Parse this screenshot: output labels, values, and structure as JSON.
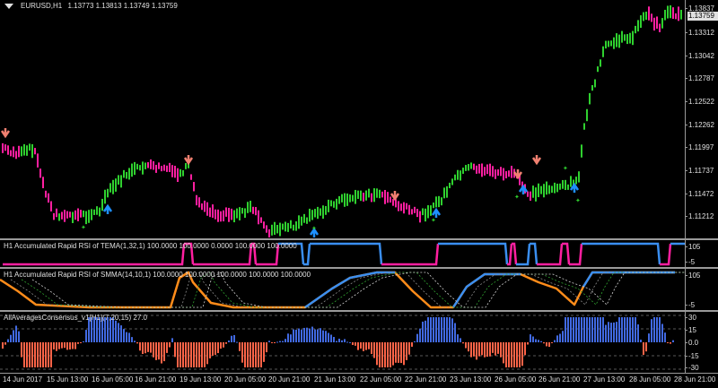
{
  "main_panel": {
    "title": "EURUSD,H1",
    "ohlc": "1.13773 1.13813 1.13749 1.13759",
    "y_ticks": [
      "1.13837",
      "1.13757",
      "1.13312",
      "1.13042",
      "1.12787",
      "1.12522",
      "1.12262",
      "1.11997",
      "1.11737",
      "1.11472",
      "1.11212"
    ],
    "current_price": "1.13759"
  },
  "rsi_tema_panel": {
    "title": "H1 Accumulated Rapid RSI of TEMA(1,32,1) 100.0000 100.0000 0.0000 100.0000 100.0000",
    "y_ticks": [
      "105",
      "-5"
    ]
  },
  "rsi_smma_panel": {
    "title": "H1 Accumulated Rapid RSI of SMMA(14,10,1) 100.0000 100.0000 100.0000 100.0000 100.0000",
    "y_ticks": [
      "105",
      "-5"
    ]
  },
  "consensus_panel": {
    "title": "AllAveragesConsensus_v1[H1](7,20,15) 27.0",
    "y_ticks": [
      "30",
      "15",
      "0.0",
      "-15",
      "-30"
    ]
  },
  "x_axis": {
    "labels": [
      "14 Jun 2017",
      "15 Jun 13:00",
      "16 Jun 05:00",
      "16 Jun 21:00",
      "19 Jun 13:00",
      "20 Jun 05:00",
      "20 Jun 21:00",
      "21 Jun 13:00",
      "22 Jun 05:00",
      "22 Jun 21:00",
      "23 Jun 13:00",
      "26 Jun 05:00",
      "26 Jun 21:00",
      "27 Jun 13:00",
      "28 Jun 05:00",
      "28 Jun 21:00"
    ]
  },
  "colors": {
    "background": "#000000",
    "text": "#e0e0e0",
    "bull_bar": "#2fd02f",
    "bear_bar": "#ff1fa0",
    "rsi_blue": "#3a8ef0",
    "rsi_magenta": "#ff1fa0",
    "rsi_orange": "#ff8c1a",
    "hist_blue": "#4169e1",
    "hist_red": "#ff6347",
    "arrow_up": "#1e90ff",
    "arrow_down": "#f08070",
    "grid": "#9a9a9a"
  }
}
